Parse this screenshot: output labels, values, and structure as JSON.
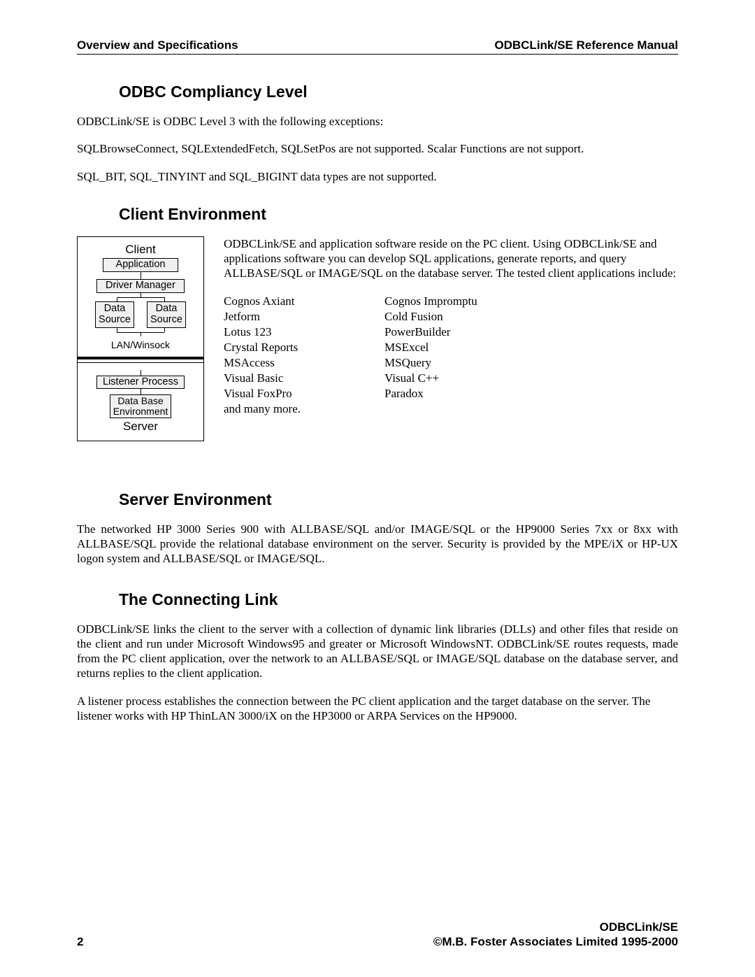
{
  "header": {
    "left": "Overview and Specifications",
    "right": "ODBCLink/SE Reference Manual"
  },
  "sections": {
    "odbc": {
      "title": "ODBC Compliancy Level",
      "p1": "ODBCLink/SE is ODBC Level 3 with the following exceptions:",
      "p2": "SQLBrowseConnect,  SQLExtendedFetch,  SQLSetPos are not supported. Scalar Functions are not support.",
      "p3": "SQL_BIT,  SQL_TINYINT and  SQL_BIGINT data types are not supported."
    },
    "client": {
      "title": "Client Environment",
      "p1": "ODBCLink/SE and application software reside on the PC client. Using ODBCLink/SE and applications software you can develop SQL applications, generate reports, and query ALLBASE/SQL or IMAGE/SQL on the database server. The tested client applications include:",
      "apps_col1": [
        "Cognos Axiant",
        "Jetform",
        "Lotus 123",
        "Crystal Reports",
        "MSAccess",
        "Visual Basic",
        "Visual FoxPro",
        "and many more."
      ],
      "apps_col2": [
        "Cognos Impromptu",
        "Cold Fusion",
        "PowerBuilder",
        "MSExcel",
        "MSQuery",
        "Visual C++",
        "Paradox"
      ]
    },
    "server": {
      "title": "Server Environment",
      "p1": "The networked HP 3000 Series 900 with ALLBASE/SQL and/or IMAGE/SQL or the HP9000 Series 7xx or 8xx with ALLBASE/SQL provide the relational database environment on the server.  Security is provided by the MPE/iX or HP-UX logon system and ALLBASE/SQL or IMAGE/SQL."
    },
    "link": {
      "title": "The Connecting Link",
      "p1": "ODBCLink/SE links the client to the server with a collection of dynamic link libraries (DLLs) and other files that reside on the client and run under Microsoft  Windows95 and greater or Microsoft WindowsNT.  ODBCLink/SE routes requests,  made from the PC client application, over the network to an ALLBASE/SQL or IMAGE/SQL database on the database server, and returns replies to the client application.",
      "p2": "A listener process establishes the connection between the PC client application and the target database on the server. The listener works with HP ThinLAN 3000/iX on the HP3000 or ARPA Services on the HP9000."
    }
  },
  "diagram": {
    "client_title": "Client",
    "application": "Application",
    "driver_manager": "Driver Manager",
    "data_source": "Data\nSource",
    "lan": "LAN/Winsock",
    "listener": "Listener Process",
    "db_env": "Data Base\nEnvironment",
    "server_title": "Server"
  },
  "footer": {
    "page": "2",
    "right1": "ODBCLink/SE",
    "right2": "©M.B. Foster Associates Limited 1995-2000"
  }
}
